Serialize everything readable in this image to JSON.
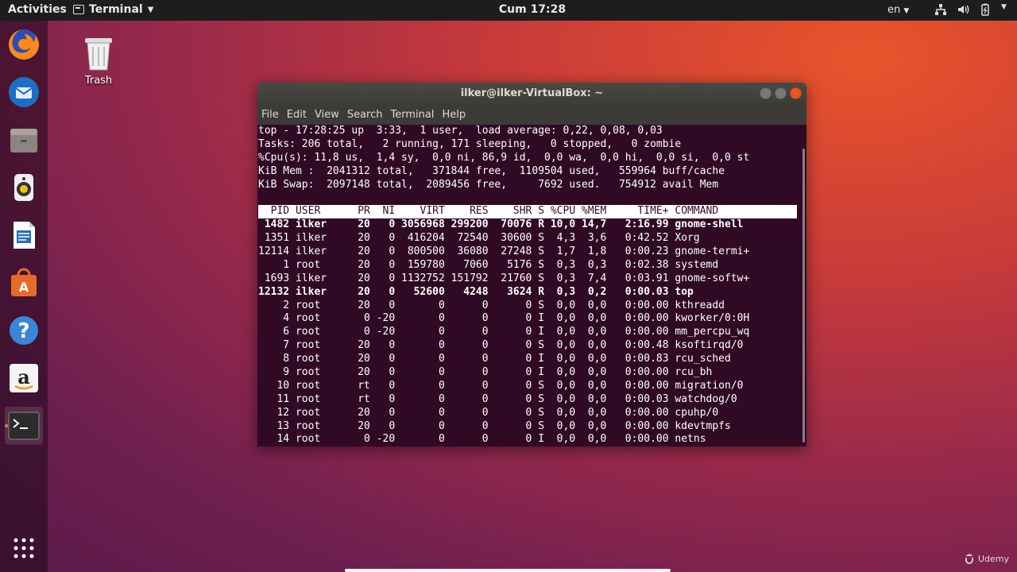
{
  "topbar": {
    "activities": "Activities",
    "app_name": "Terminal",
    "clock": "Cum 17:28",
    "lang": "en"
  },
  "desktop": {
    "trash_label": "Trash"
  },
  "window": {
    "title": "ilker@ilker-VirtualBox: ~",
    "menu": [
      "File",
      "Edit",
      "View",
      "Search",
      "Terminal",
      "Help"
    ]
  },
  "top": {
    "summary": [
      "top - 17:28:25 up  3:33,  1 user,  load average: 0,22, 0,08, 0,03",
      "Tasks: 206 total,   2 running, 171 sleeping,   0 stopped,   0 zombie",
      "%Cpu(s): 11,8 us,  1,4 sy,  0,0 ni, 86,9 id,  0,0 wa,  0,0 hi,  0,0 si,  0,0 st",
      "KiB Mem :  2041312 total,   371844 free,  1109504 used,   559964 buff/cache",
      "KiB Swap:  2097148 total,  2089456 free,     7692 used.   754912 avail Mem"
    ],
    "header": "  PID USER      PR  NI    VIRT    RES    SHR S %CPU %MEM     TIME+ COMMAND     ",
    "rows": [
      {
        "text": " 1482 ilker     20   0 3056968 299200  70076 R 10,0 14,7   2:16.99 gnome-shell",
        "bold": true
      },
      {
        "text": " 1351 ilker     20   0  416204  72540  30600 S  4,3  3,6   0:42.52 Xorg",
        "bold": false
      },
      {
        "text": "12114 ilker     20   0  800500  36080  27248 S  1,7  1,8   0:00.23 gnome-termi+",
        "bold": false
      },
      {
        "text": "    1 root      20   0  159780   7060   5176 S  0,3  0,3   0:02.38 systemd",
        "bold": false
      },
      {
        "text": " 1693 ilker     20   0 1132752 151792  21760 S  0,3  7,4   0:03.91 gnome-softw+",
        "bold": false
      },
      {
        "text": "12132 ilker     20   0   52600   4248   3624 R  0,3  0,2   0:00.03 top",
        "bold": true
      },
      {
        "text": "    2 root      20   0       0      0      0 S  0,0  0,0   0:00.00 kthreadd",
        "bold": false
      },
      {
        "text": "    4 root       0 -20       0      0      0 I  0,0  0,0   0:00.00 kworker/0:0H",
        "bold": false
      },
      {
        "text": "    6 root       0 -20       0      0      0 I  0,0  0,0   0:00.00 mm_percpu_wq",
        "bold": false
      },
      {
        "text": "    7 root      20   0       0      0      0 S  0,0  0,0   0:00.48 ksoftirqd/0",
        "bold": false
      },
      {
        "text": "    8 root      20   0       0      0      0 I  0,0  0,0   0:00.83 rcu_sched",
        "bold": false
      },
      {
        "text": "    9 root      20   0       0      0      0 I  0,0  0,0   0:00.00 rcu_bh",
        "bold": false
      },
      {
        "text": "   10 root      rt   0       0      0      0 S  0,0  0,0   0:00.00 migration/0",
        "bold": false
      },
      {
        "text": "   11 root      rt   0       0      0      0 S  0,0  0,0   0:00.03 watchdog/0",
        "bold": false
      },
      {
        "text": "   12 root      20   0       0      0      0 S  0,0  0,0   0:00.00 cpuhp/0",
        "bold": false
      },
      {
        "text": "   13 root      20   0       0      0      0 S  0,0  0,0   0:00.00 kdevtmpfs",
        "bold": false
      },
      {
        "text": "   14 root       0 -20       0      0      0 I  0,0  0,0   0:00.00 netns",
        "bold": false
      }
    ]
  },
  "watermark": "Udemy",
  "colors": {
    "accent": "#e95420",
    "terminal_bg": "#300a24"
  }
}
